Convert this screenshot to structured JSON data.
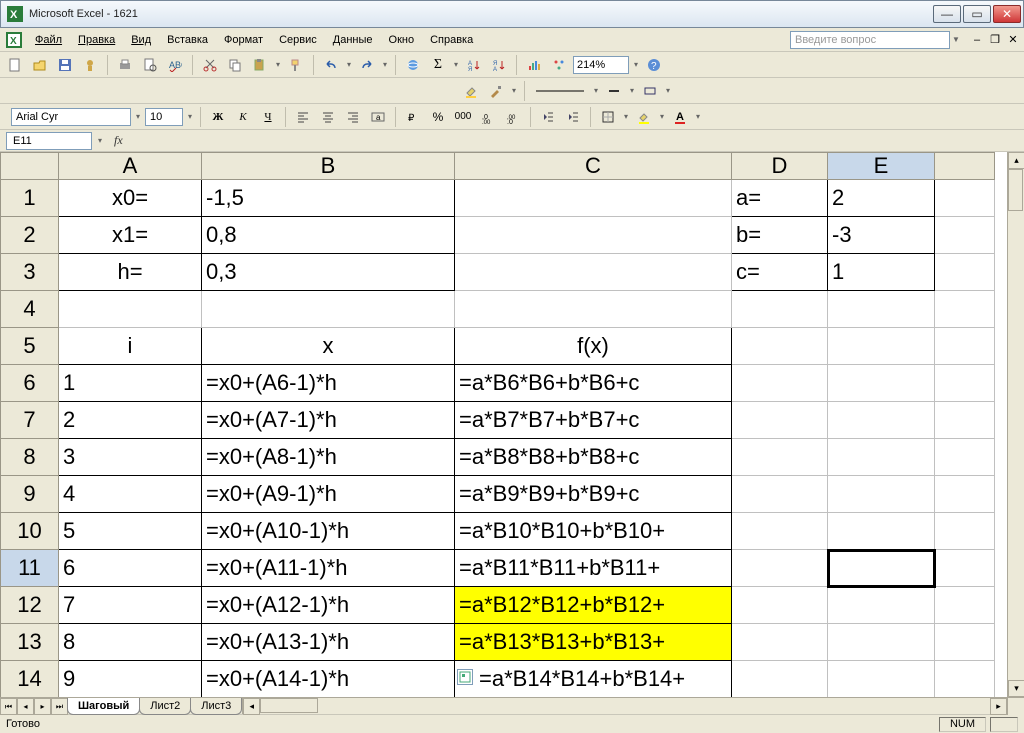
{
  "window": {
    "title": "Microsoft Excel - 1621"
  },
  "menu": {
    "file": "Файл",
    "edit": "Правка",
    "view": "Вид",
    "insert": "Вставка",
    "format": "Формат",
    "service": "Сервис",
    "data": "Данные",
    "window": "Окно",
    "help": "Справка",
    "ask_placeholder": "Введите вопрос"
  },
  "toolbar": {
    "zoom": "214%"
  },
  "fmt": {
    "font": "Arial Cyr",
    "size": "10"
  },
  "formula": {
    "namebox": "E11",
    "value": ""
  },
  "columns": [
    "A",
    "B",
    "C",
    "D",
    "E"
  ],
  "rows": [
    "1",
    "2",
    "3",
    "4",
    "5",
    "6",
    "7",
    "8",
    "9",
    "10",
    "11",
    "12",
    "13",
    "14"
  ],
  "cells": {
    "A1": "x0=",
    "B1": "-1,5",
    "D1": "a=",
    "E1": "2",
    "A2": "x1=",
    "B2": "0,8",
    "D2": "b=",
    "E2": "-3",
    "A3": "h=",
    "B3": "0,3",
    "D3": "c=",
    "E3": "1",
    "A5": "i",
    "B5": "x",
    "C5": "f(x)",
    "A6": "1",
    "B6": "=x0+(A6-1)*h",
    "C6": "=a*B6*B6+b*B6+c",
    "A7": "2",
    "B7": "=x0+(A7-1)*h",
    "C7": "=a*B7*B7+b*B7+c",
    "A8": "3",
    "B8": "=x0+(A8-1)*h",
    "C8": "=a*B8*B8+b*B8+c",
    "A9": "4",
    "B9": "=x0+(A9-1)*h",
    "C9": "=a*B9*B9+b*B9+c",
    "A10": "5",
    "B10": "=x0+(A10-1)*h",
    "C10": "=a*B10*B10+b*B10+",
    "A11": "6",
    "B11": "=x0+(A11-1)*h",
    "C11": "=a*B11*B11+b*B11+",
    "A12": "7",
    "B12": "=x0+(A12-1)*h",
    "C12": "=a*B12*B12+b*B12+",
    "A13": "8",
    "B13": "=x0+(A13-1)*h",
    "C13": "=a*B13*B13+b*B13+",
    "A14": "9",
    "B14": "=x0+(A14-1)*h",
    "C14": "=a*B14*B14+b*B14+"
  },
  "tabs": {
    "t1": "Шаговый",
    "t2": "Лист2",
    "t3": "Лист3"
  },
  "status": {
    "ready": "Готово",
    "num": "NUM"
  },
  "active_cell": "E11",
  "highlighted_cells": [
    "C12",
    "C13"
  ]
}
